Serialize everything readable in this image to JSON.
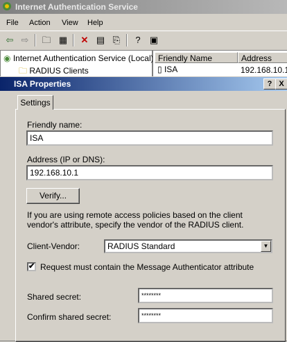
{
  "mmc": {
    "title": "Internet Authentication Service",
    "menu": [
      "File",
      "Action",
      "View",
      "Help"
    ],
    "tree": {
      "root": "Internet Authentication Service (Local)",
      "child": "RADIUS Clients"
    },
    "list": {
      "columns": [
        "Friendly Name",
        "Address"
      ],
      "rows": [
        {
          "name": "ISA",
          "address": "192.168.10.1"
        }
      ]
    }
  },
  "dialog": {
    "title": "ISA Properties",
    "help_btn": "?",
    "close_btn": "X",
    "tab": "Settings",
    "friendly_name_label": "Friendly name:",
    "friendly_name_value": "ISA",
    "address_label": "Address (IP or DNS):",
    "address_value": "192.168.10.1",
    "verify_button": "Verify...",
    "vendor_note": "If you are using remote access policies based on the client vendor's attribute, specify the vendor of the RADIUS client.",
    "client_vendor_label": "Client-Vendor:",
    "client_vendor_value": "RADIUS Standard",
    "msg_auth_label": "Request must contain the Message Authenticator attribute",
    "msg_auth_checked": "✔",
    "shared_secret_label": "Shared secret:",
    "shared_secret_value": "********",
    "confirm_secret_label": "Confirm shared secret:",
    "confirm_secret_value": "********"
  }
}
